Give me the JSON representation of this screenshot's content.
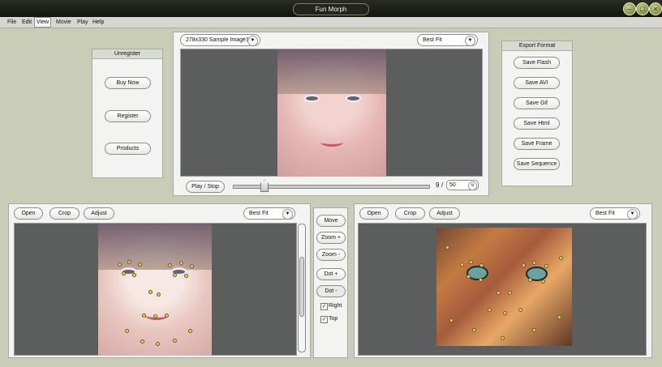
{
  "window": {
    "title": "Fun Morph"
  },
  "menu": [
    "File",
    "Edit",
    "View",
    "Movie",
    "Play",
    "Help"
  ],
  "unregister": {
    "title": "Unregister",
    "buttons": [
      "Buy Now",
      "Register",
      "Products"
    ]
  },
  "preview": {
    "image_select": "278x330 Sample Image1",
    "fit_select": "Best Fit",
    "play_button": "Play / Stop",
    "frame_current": "9",
    "frame_separator": "/",
    "frame_total": "50"
  },
  "export": {
    "title": "Export Format",
    "buttons": [
      "Save Flash",
      "Save AVI",
      "Save Gif",
      "Save Html",
      "Save Frame",
      "Save Sequence"
    ]
  },
  "left_editor": {
    "open": "Open",
    "crop": "Crop",
    "adjust": "Adjust",
    "fit_select": "Best Fit"
  },
  "right_editor": {
    "open": "Open",
    "crop": "Crop",
    "adjust": "Adjust",
    "fit_select": "Best Fit"
  },
  "tools": {
    "buttons": [
      "Move",
      "Zoom +",
      "Zoom -",
      "Dot +",
      "Dot -"
    ],
    "right_label": "Right",
    "top_label": "Top",
    "right_checked": true,
    "top_checked": true
  },
  "icons": {
    "minimize": "minimize-icon",
    "maximize": "maximize-icon",
    "close": "close-icon",
    "dropdown": "chevron-down-icon",
    "spinner": "spin-icon",
    "check": "check-icon"
  }
}
